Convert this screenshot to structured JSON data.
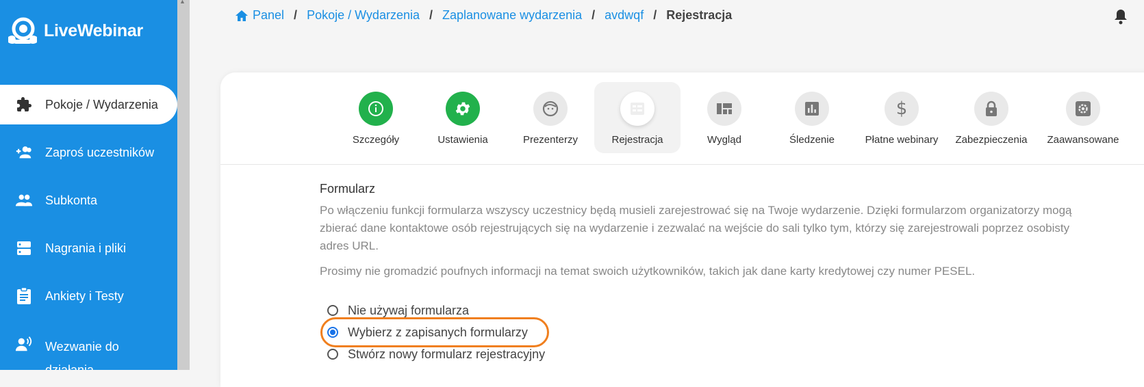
{
  "brand": {
    "name": "LiveWebinar"
  },
  "sidebar": {
    "items": [
      {
        "label": "Pokoje / Wydarzenia",
        "icon": "puzzle-icon",
        "active": true
      },
      {
        "label": "Zaproś uczestników",
        "icon": "add-users-icon",
        "active": false
      },
      {
        "label": "Subkonta",
        "icon": "group-icon",
        "active": false
      },
      {
        "label": "Nagrania i pliki",
        "icon": "storage-icon",
        "active": false
      },
      {
        "label": "Ankiety i Testy",
        "icon": "clipboard-icon",
        "active": false
      },
      {
        "label": "Wezwanie do działania",
        "icon": "voice-call-icon",
        "active": false
      }
    ]
  },
  "breadcrumb": {
    "items": [
      "Panel",
      "Pokoje / Wydarzenia",
      "Zaplanowane wydarzenia",
      "avdwqf"
    ],
    "separator": "/",
    "current": "Rejestracja"
  },
  "tabs": [
    {
      "label": "Szczegóły",
      "icon": "info-icon",
      "state": "done"
    },
    {
      "label": "Ustawienia",
      "icon": "gear-icon",
      "state": "done"
    },
    {
      "label": "Prezenterzy",
      "icon": "face-icon",
      "state": "default"
    },
    {
      "label": "Rejestracja",
      "icon": "form-icon",
      "state": "active"
    },
    {
      "label": "Wygląd",
      "icon": "layout-icon",
      "state": "default"
    },
    {
      "label": "Śledzenie",
      "icon": "chart-icon",
      "state": "default"
    },
    {
      "label": "Płatne webinary",
      "icon": "dollar-icon",
      "state": "default"
    },
    {
      "label": "Zabezpieczenia",
      "icon": "lock-icon",
      "state": "default"
    },
    {
      "label": "Zaawansowane",
      "icon": "advanced-settings-icon",
      "state": "default"
    }
  ],
  "form_section": {
    "title": "Formularz",
    "description": "Po włączeniu funkcji formularza wszyscy uczestnicy będą musieli zarejestrować się na Twoje wydarzenie. Dzięki formularzom organizatorzy mogą zbierać dane kontaktowe osób rejestrujących się na wydarzenie i zezwalać na wejście do sali tylko tym, którzy się zarejestrowali poprzez osobisty adres URL.",
    "note": "Prosimy nie gromadzić poufnych informacji na temat swoich użytkowników, takich jak dane karty kredytowej czy numer PESEL.",
    "options": [
      {
        "label": "Nie używaj formularza",
        "selected": false
      },
      {
        "label": "Wybierz z zapisanych formularzy",
        "selected": true
      },
      {
        "label": "Stwórz nowy formularz rejestracyjny",
        "selected": false
      }
    ]
  },
  "colors": {
    "primary": "#1a8fe3",
    "success": "#22b14c",
    "highlight": "#f07f1e"
  }
}
